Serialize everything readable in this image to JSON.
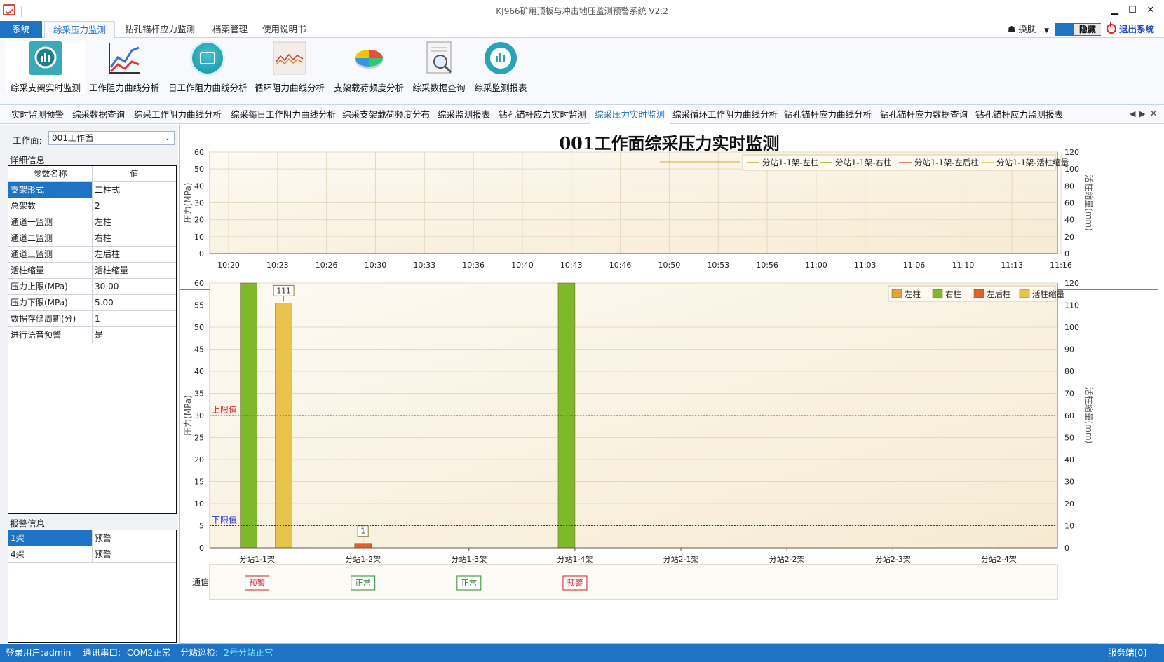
{
  "window": {
    "title": "KJ966矿用顶板与冲击地压监测预警系统  V2.2",
    "minimize": "▁",
    "maximize": "☐",
    "close": "✕"
  },
  "menu": {
    "tabs": [
      "系统",
      "综采压力监测",
      "钻孔锚杆应力监测",
      "档案管理",
      "使用说明书"
    ],
    "skin_label": "换肤",
    "hide_label": "隐藏",
    "exit_label": "退出系统"
  },
  "ribbon": {
    "buttons": [
      "综采支架实时监测",
      "工作阻力曲线分析",
      "日工作阻力曲线分析",
      "循环阻力曲线分析",
      "支架载荷频度分析",
      "综采数据查询",
      "综采监测报表"
    ]
  },
  "doc_tabs": [
    "实时监测预警",
    "综采数据查询",
    "综采工作阻力曲线分析",
    "综采每日工作阻力曲线分析",
    "综采支架载荷频度分布",
    "综采监测报表",
    "钻孔锚杆应力实时监测",
    "综采压力实时监测",
    "综采循环工作阻力曲线分析",
    "钻孔锚杆应力曲线分析",
    "钻孔锚杆应力数据查询",
    "钻孔锚杆应力监测报表"
  ],
  "doc_tab_controls": [
    "◀",
    "▶",
    "✕"
  ],
  "left": {
    "workface_label": "工作面:",
    "workface_value": "001工作面",
    "detail_title": "详细信息",
    "detail_header": {
      "key": "参数名称",
      "value": "值"
    },
    "detail_rows": [
      {
        "key": "支架形式",
        "value": "二柱式"
      },
      {
        "key": "总架数",
        "value": "2"
      },
      {
        "key": "通道一监测",
        "value": "左柱"
      },
      {
        "key": "通道二监测",
        "value": "右柱"
      },
      {
        "key": "通道三监测",
        "value": "左后柱"
      },
      {
        "key": "活柱缩量",
        "value": "活柱缩量"
      },
      {
        "key": "压力上限(MPa)",
        "value": "30.00"
      },
      {
        "key": "压力下限(MPa)",
        "value": "5.00"
      },
      {
        "key": "数据存储周期(分)",
        "value": "1"
      },
      {
        "key": "进行语音预警",
        "value": "是"
      }
    ],
    "alarm_title": "报警信息",
    "alarm_rows": [
      {
        "key": "1架",
        "value": "预警"
      },
      {
        "key": "4架",
        "value": "预警"
      }
    ]
  },
  "chart_title": "001工作面综采压力实时监测",
  "colors": {
    "accent": "#1f73c4",
    "left_col": "#e3a33d",
    "right_col": "#7fb82a",
    "left_rear_col": "#e0602e",
    "shrink": "#e8c24a",
    "upper_limit": "#e02020",
    "lower_limit": "#2030d0"
  },
  "chart_data": [
    {
      "type": "line",
      "x": [
        "10:20",
        "10:23",
        "10:26",
        "10:30",
        "10:33",
        "10:36",
        "10:40",
        "10:43",
        "10:46",
        "10:50",
        "10:53",
        "10:56",
        "11:00",
        "11:03",
        "11:06",
        "11:10",
        "11:13",
        "11:16"
      ],
      "ylabel": "压力(MPa)",
      "y2label": "活柱缩量(mm)",
      "ylim": [
        0,
        60
      ],
      "y2lim": [
        0,
        120
      ],
      "yticks": [
        "0",
        "10",
        "20",
        "30",
        "40",
        "50",
        "60"
      ],
      "y2ticks": [
        "0",
        "20",
        "40",
        "60",
        "80",
        "100",
        "120"
      ],
      "legend": "top-right",
      "grid": true,
      "series": [
        {
          "name": "分站1-1架-左柱",
          "values": []
        },
        {
          "name": "分站1-1架-右柱",
          "values": []
        },
        {
          "name": "分站1-1架-左后柱",
          "values": []
        },
        {
          "name": "分站1-1架-活柱缩量",
          "values": []
        }
      ]
    },
    {
      "type": "bar",
      "categories": [
        "分站1-1架",
        "分站1-2架",
        "分站1-3架",
        "分站1-4架",
        "分站2-1架",
        "分站2-2架",
        "分站2-3架",
        "分站2-4架"
      ],
      "ylabel": "压力(MPa)",
      "y2label": "活柱缩量(mm)",
      "ylim": [
        0,
        60
      ],
      "y2lim": [
        0,
        120
      ],
      "yticks": [
        "0",
        "5",
        "10",
        "15",
        "20",
        "25",
        "30",
        "35",
        "40",
        "45",
        "50",
        "55",
        "60"
      ],
      "y2ticks": [
        "0",
        "10",
        "20",
        "30",
        "40",
        "50",
        "60",
        "70",
        "80",
        "90",
        "100",
        "110",
        "120"
      ],
      "legend": "top-right",
      "grid": true,
      "series": [
        {
          "name": "左柱",
          "axis": "left",
          "values": [
            0,
            0,
            0,
            0,
            0,
            0,
            0,
            0
          ]
        },
        {
          "name": "右柱",
          "axis": "left",
          "values": [
            60,
            0,
            0,
            60,
            0,
            0,
            0,
            0
          ]
        },
        {
          "name": "左后柱",
          "axis": "left",
          "values": [
            0,
            1,
            0,
            0,
            0,
            0,
            0,
            0
          ]
        },
        {
          "name": "活柱缩量",
          "axis": "right",
          "values": [
            111,
            0,
            0,
            0,
            0,
            0,
            0,
            0
          ]
        }
      ],
      "data_labels": [
        {
          "category": "分站1-1架",
          "series": "活柱缩量",
          "text": "111"
        },
        {
          "category": "分站1-2架",
          "series": "左后柱",
          "text": "1"
        }
      ],
      "reference_lines": [
        {
          "label": "上限值",
          "value": 30
        },
        {
          "label": "下限值",
          "value": 5
        }
      ],
      "comm_label": "通信",
      "comm_status": [
        {
          "category": "分站1-1架",
          "text": "预警"
        },
        {
          "category": "分站1-2架",
          "text": "正常"
        },
        {
          "category": "分站1-3架",
          "text": "正常"
        },
        {
          "category": "分站1-4架",
          "text": "预警"
        }
      ]
    }
  ],
  "status": {
    "user": "登录用户:admin",
    "port_label": "通讯串口:",
    "port_value": "COM2正常",
    "patrol_label": "分站巡检:",
    "patrol_value": "2号分站正常",
    "server": "服务端[0]"
  }
}
